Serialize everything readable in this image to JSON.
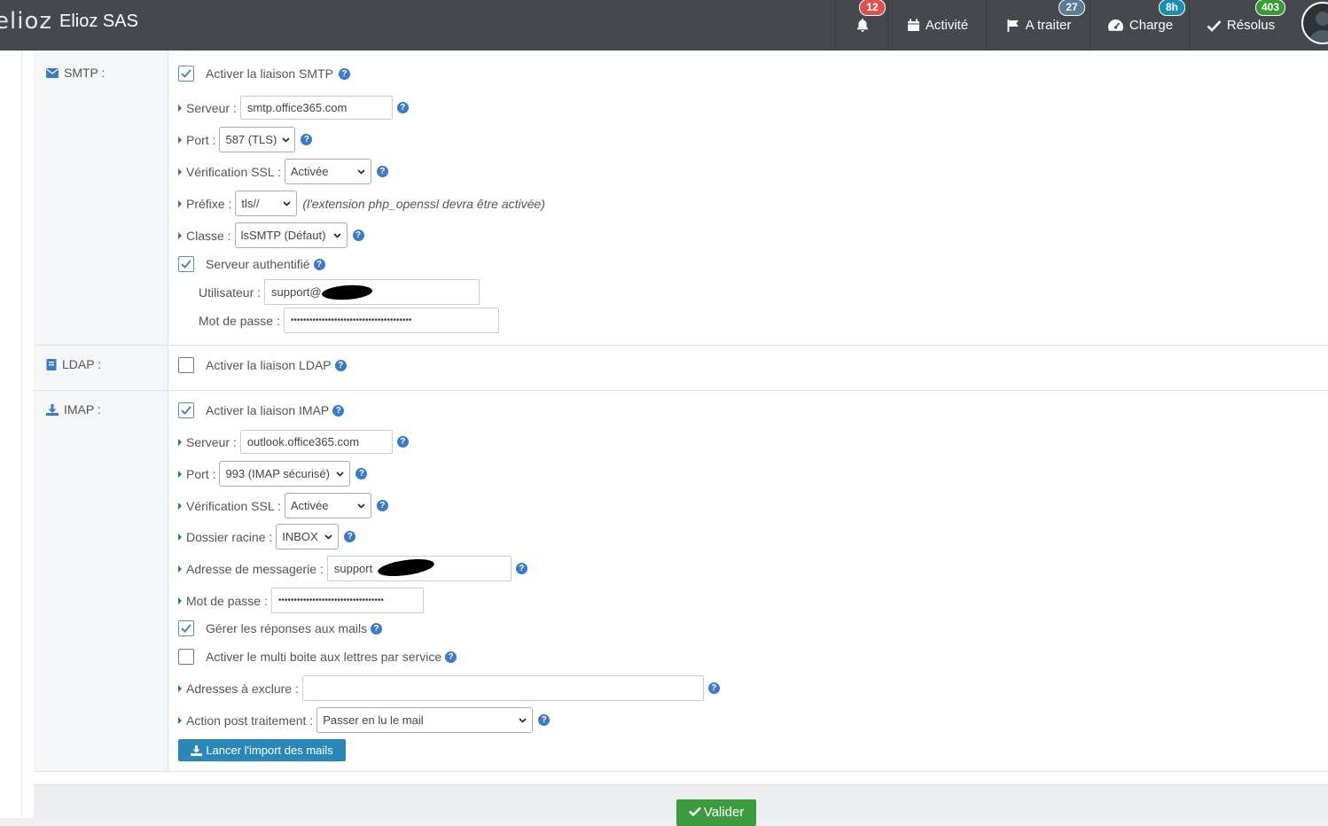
{
  "header": {
    "logo_text": "elioz",
    "company": "Elioz SAS",
    "notifications_badge": "12",
    "nav": [
      {
        "label": "Activité",
        "badge": ""
      },
      {
        "label": "A traiter",
        "badge": "27",
        "badge_color": "#5b7a93"
      },
      {
        "label": "Charge",
        "badge": "8h",
        "badge_color": "#1b8fb0"
      },
      {
        "label": "Résolus",
        "badge": "403",
        "badge_color": "#3a9a3a"
      }
    ]
  },
  "smtp": {
    "section_label": "SMTP :",
    "enable_label": "Activer la liaison SMTP",
    "enable_checked": true,
    "server_label": "Serveur :",
    "server_value": "smtp.office365.com",
    "port_label": "Port :",
    "port_value": "587 (TLS)",
    "ssl_label": "Vérification SSL :",
    "ssl_value": "Activée",
    "prefix_label": "Préfixe :",
    "prefix_value": "tls//",
    "prefix_note": "(l'extension php_openssl devra être activée)",
    "class_label": "Classe :",
    "class_value": "lsSMTP (Défaut)",
    "auth_label": "Serveur authentifié",
    "auth_checked": true,
    "user_label": "Utilisateur :",
    "user_value": "support@",
    "password_label": "Mot de passe :",
    "password_value": "•••••••••••••••••••••••••••••••••••••••"
  },
  "ldap": {
    "section_label": "LDAP :",
    "enable_label": "Activer la liaison LDAP",
    "enable_checked": false
  },
  "imap": {
    "section_label": "IMAP :",
    "enable_label": "Activer la liaison IMAP",
    "enable_checked": true,
    "server_label": "Serveur :",
    "server_value": "outlook.office365.com",
    "port_label": "Port :",
    "port_value": "993 (IMAP sécurisé)",
    "ssl_label": "Vérification SSL :",
    "ssl_value": "Activée",
    "root_label": "Dossier racine :",
    "root_value": "INBOX",
    "email_label": "Adresse de messagerie :",
    "email_value": "support",
    "password_label": "Mot de passe :",
    "password_value": "••••••••••••••••••••••••••••••••••",
    "replies_label": "Gérer les réponses aux mails",
    "replies_checked": true,
    "multi_label": "Activer le multi boite aux lettres par service",
    "multi_checked": false,
    "exclude_label": "Adresses à exclure :",
    "exclude_value": "",
    "post_label": "Action post traitement :",
    "post_value": "Passer en lu le mail",
    "import_button": "Lancer l'import des mails"
  },
  "footer": {
    "validate_button": "Valider"
  }
}
